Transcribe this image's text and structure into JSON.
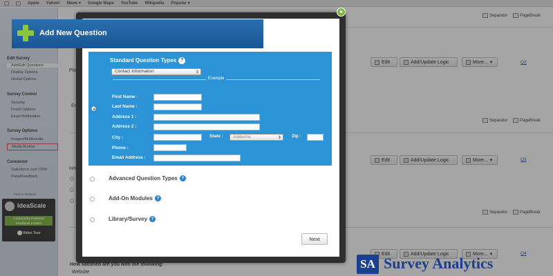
{
  "browser": {
    "bookmarks": [
      "Apple",
      "Yahoo!",
      "News ▾",
      "Google Maps",
      "YouTube",
      "Wikipedia",
      "Popular ▾"
    ]
  },
  "sidebar": {
    "sections": [
      {
        "title": "Edit Survey",
        "items": [
          "Add/Edit Questions",
          "Display Options",
          "Global Options"
        ]
      },
      {
        "title": "Survey Control",
        "items": [
          "Security",
          "Finish Options",
          "Email Notification"
        ]
      },
      {
        "title": "Survey Options",
        "items": [
          "Images/Multimedia",
          "Media Bunker"
        ]
      },
      {
        "title": "Connector",
        "items": [
          "Salesforce.com CRM",
          "RapidFeedback"
        ]
      }
    ],
    "partner_label": "Partner Network",
    "ad": {
      "name": "IdeaScale",
      "tagline_1": "Community Powered",
      "tagline_2": "Feedback Portals",
      "tour_label": "Video Tour"
    }
  },
  "page": {
    "separator_label": "Separator",
    "pagebreak_label": "PageBreak",
    "edit_label": "Edit",
    "logic_label": "Add/Update Logic",
    "more_label": "More...",
    "q_links": [
      "Q2",
      "Q3",
      "Q4"
    ],
    "partial_texts": [
      "Plea",
      "Em",
      "How"
    ],
    "bottom_question": "How satisfied are you with the following:",
    "bottom_item": "Website"
  },
  "modal": {
    "title": "Add New Question",
    "close_label": "×",
    "standard_types_label": "Standard Question Types",
    "help_label": "?",
    "selected_type": "Contact Information",
    "example_label": "Example",
    "fields": {
      "first_name": "First Name :",
      "last_name": "Last Name :",
      "address1": "Address 1 :",
      "address2": "Address 2 :",
      "city": "City :",
      "state": "State :",
      "state_value": "Alabama",
      "zip": "Zip :",
      "phone": "Phone :",
      "email": "Email Address :"
    },
    "options": [
      "Advanced Question Types",
      "Add-On Modules",
      "Library/Survey"
    ],
    "next_label": "Next"
  },
  "watermark": {
    "logo_text": "SA",
    "brand": "Survey Analytics"
  },
  "colors": {
    "header_blue": "#1b5593",
    "panel_blue": "#2b93d6",
    "accent_green": "#8cc63f",
    "brand_navy": "#1c3f8f"
  }
}
